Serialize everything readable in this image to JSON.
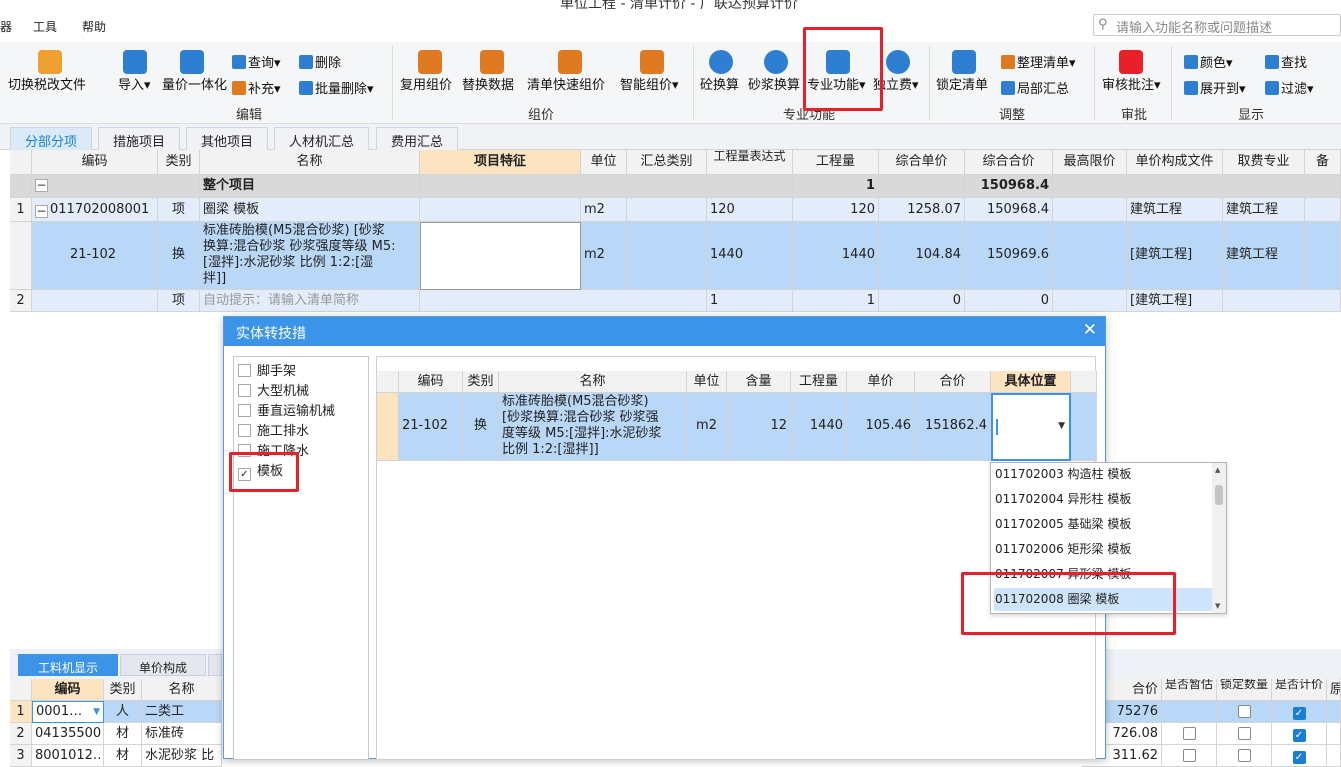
{
  "window": {
    "title": "单位工程 - 清单计价 - 广联达预算计价"
  },
  "menu": {
    "m1": "器",
    "m2": "工具",
    "m3": "帮助"
  },
  "search": {
    "placeholder": "请输入功能名称或问题描述"
  },
  "ribbon": {
    "tax": "切换税改文件",
    "import": "导入",
    "qtyprice": "量价一体化",
    "query": "查询",
    "supplement": "补充",
    "delete": "删除",
    "batch_delete": "批量删除",
    "reuse": "复用组价",
    "replace": "替换数据",
    "quick": "清单快速组价",
    "smart": "智能组价",
    "concrete": "砼换算",
    "mortar": "砂浆换算",
    "special": "专业功能",
    "standalone": "独立费",
    "lock": "锁定清单",
    "organize": "整理清单",
    "partial": "局部汇总",
    "review": "审核批注",
    "color": "颜色",
    "expand": "展开到",
    "find": "查找",
    "filter": "过滤",
    "groups": {
      "edit": "编辑",
      "pricing": "组价",
      "special": "专业功能",
      "adjust": "调整",
      "approve": "审批",
      "display": "显示"
    }
  },
  "tabs": [
    "分部分项",
    "措施项目",
    "其他项目",
    "人材机汇总",
    "费用汇总"
  ],
  "grid": {
    "headers": [
      "编码",
      "类别",
      "名称",
      "项目特征",
      "单位",
      "汇总类别",
      "工程量表达式",
      "工程量",
      "综合单价",
      "综合合价",
      "最高限价",
      "单价构成文件",
      "取费专业",
      "备"
    ],
    "total": {
      "name": "整个项目",
      "qty": "1",
      "sum": "150968.4"
    },
    "row1": {
      "no": "1",
      "code": "011702008001",
      "type": "项",
      "name": "圈梁 模板",
      "unit": "m2",
      "expr": "120",
      "qty": "120",
      "price": "1258.07",
      "sum": "150968.4",
      "file": "建筑工程",
      "major": "建筑工程"
    },
    "sub": {
      "code": "21-102",
      "type": "换",
      "name1": "标准砖胎模(M5混合砂浆)  [砂浆",
      "name2": "换算:混合砂浆 砂浆强度等级 M5:",
      "name3": "[湿拌]:水泥砂浆 比例 1:2:[湿",
      "name4": "拌]]",
      "unit": "m2",
      "expr": "1440",
      "qty": "1440",
      "price": "104.84",
      "sum": "150969.6",
      "file": "[建筑工程]",
      "major": "建筑工程"
    },
    "row2": {
      "no": "2",
      "type": "项",
      "name": "自动提示：请输入清单简称",
      "expr": "1",
      "qty": "1",
      "price": "0",
      "sum": "0",
      "file": "[建筑工程]"
    }
  },
  "dialog": {
    "title": "实体转技措",
    "categories": [
      "脚手架",
      "大型机械",
      "垂直运输机械",
      "施工排水",
      "施工降水",
      "模板"
    ],
    "headers": [
      "编码",
      "类别",
      "名称",
      "单位",
      "含量",
      "工程量",
      "单价",
      "合价",
      "具体位置"
    ],
    "row": {
      "code": "21-102",
      "type": "换",
      "name1": "标准砖胎模(M5混合砂浆)",
      "name2": "[砂浆换算:混合砂浆 砂浆强",
      "name3": "度等级 M5:[湿拌]:水泥砂浆",
      "name4": "比例 1:2:[湿拌]]",
      "unit": "m2",
      "content": "12",
      "qty": "1440",
      "price": "105.46",
      "sum": "151862.4"
    },
    "options": [
      "011702003 构造柱 模板",
      "011702004 异形柱 模板",
      "011702005 基础梁 模板",
      "011702006 矩形梁 模板",
      "011702007 异形梁 模板",
      "011702008 圈梁 模板"
    ]
  },
  "bottom": {
    "tab1": "工料机显示",
    "tab2": "单价构成",
    "headers": [
      "编码",
      "类别",
      "名称"
    ],
    "right_headers": [
      "合价",
      "是否暂估",
      "锁定数量",
      "是否计价",
      "原"
    ],
    "rows": [
      {
        "no": "1",
        "code": "0001…",
        "type": "人",
        "name": "二类工",
        "sum": "75276"
      },
      {
        "no": "2",
        "code": "04135500",
        "type": "材",
        "name": "标准砖",
        "sum": "726.08"
      },
      {
        "no": "3",
        "code": "8001012…",
        "type": "材",
        "name": "水泥砂浆 比",
        "sum": "311.62"
      }
    ]
  },
  "colors": {
    "accent": "#3c94e8",
    "selected": "#b9d7f7",
    "highlight": "#e8202a"
  }
}
